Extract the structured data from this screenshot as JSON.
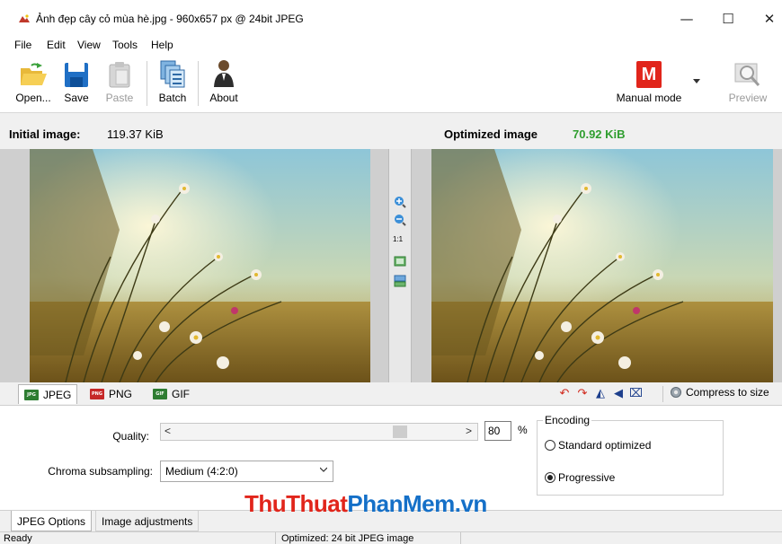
{
  "window": {
    "title": "Ảnh đẹp cây cỏ mùa hè.jpg - 960x657 px @ 24bit JPEG",
    "minimize": "—",
    "maximize": "☐",
    "close": "✕"
  },
  "menu": [
    "File",
    "Edit",
    "View",
    "Tools",
    "Help"
  ],
  "toolbar": {
    "open": "Open...",
    "save": "Save",
    "paste": "Paste",
    "batch": "Batch",
    "about": "About",
    "manual_mode": "Manual mode",
    "manual_mode_letter": "M",
    "preview": "Preview"
  },
  "images": {
    "initial_label": "Initial image:",
    "initial_size": "119.37 KiB",
    "optimized_label": "Optimized image",
    "optimized_size": "70.92 KiB"
  },
  "zoom_tools": {
    "one_to_one": "1:1"
  },
  "formats": {
    "tabs": [
      {
        "label": "JPEG",
        "icon_text": "JPG",
        "color": "#2e7d32"
      },
      {
        "label": "PNG",
        "icon_text": "PNG",
        "color": "#c62828"
      },
      {
        "label": "GIF",
        "icon_text": "GIF",
        "color": "#2e7d32"
      }
    ],
    "compress_to_size": "Compress to size"
  },
  "options": {
    "quality_label": "Quality:",
    "quality_value": "80",
    "quality_unit": "%",
    "quality_fraction": 0.8,
    "chroma_label": "Chroma subsampling:",
    "chroma_value": "Medium (4:2:0)",
    "encoding_label": "Encoding",
    "encoding_standard": "Standard optimized",
    "encoding_progressive": "Progressive",
    "encoding_selected": "Progressive"
  },
  "bottom_tabs": [
    "JPEG Options",
    "Image adjustments"
  ],
  "watermark": {
    "part_a": "ThuThuat",
    "part_b": "PhanMem.vn"
  },
  "status": {
    "left": "Ready",
    "middle": "Optimized: 24 bit JPEG image"
  },
  "colors": {
    "optimized_size": "#2f9e2f",
    "manual_mode_badge": "#e1251b"
  }
}
